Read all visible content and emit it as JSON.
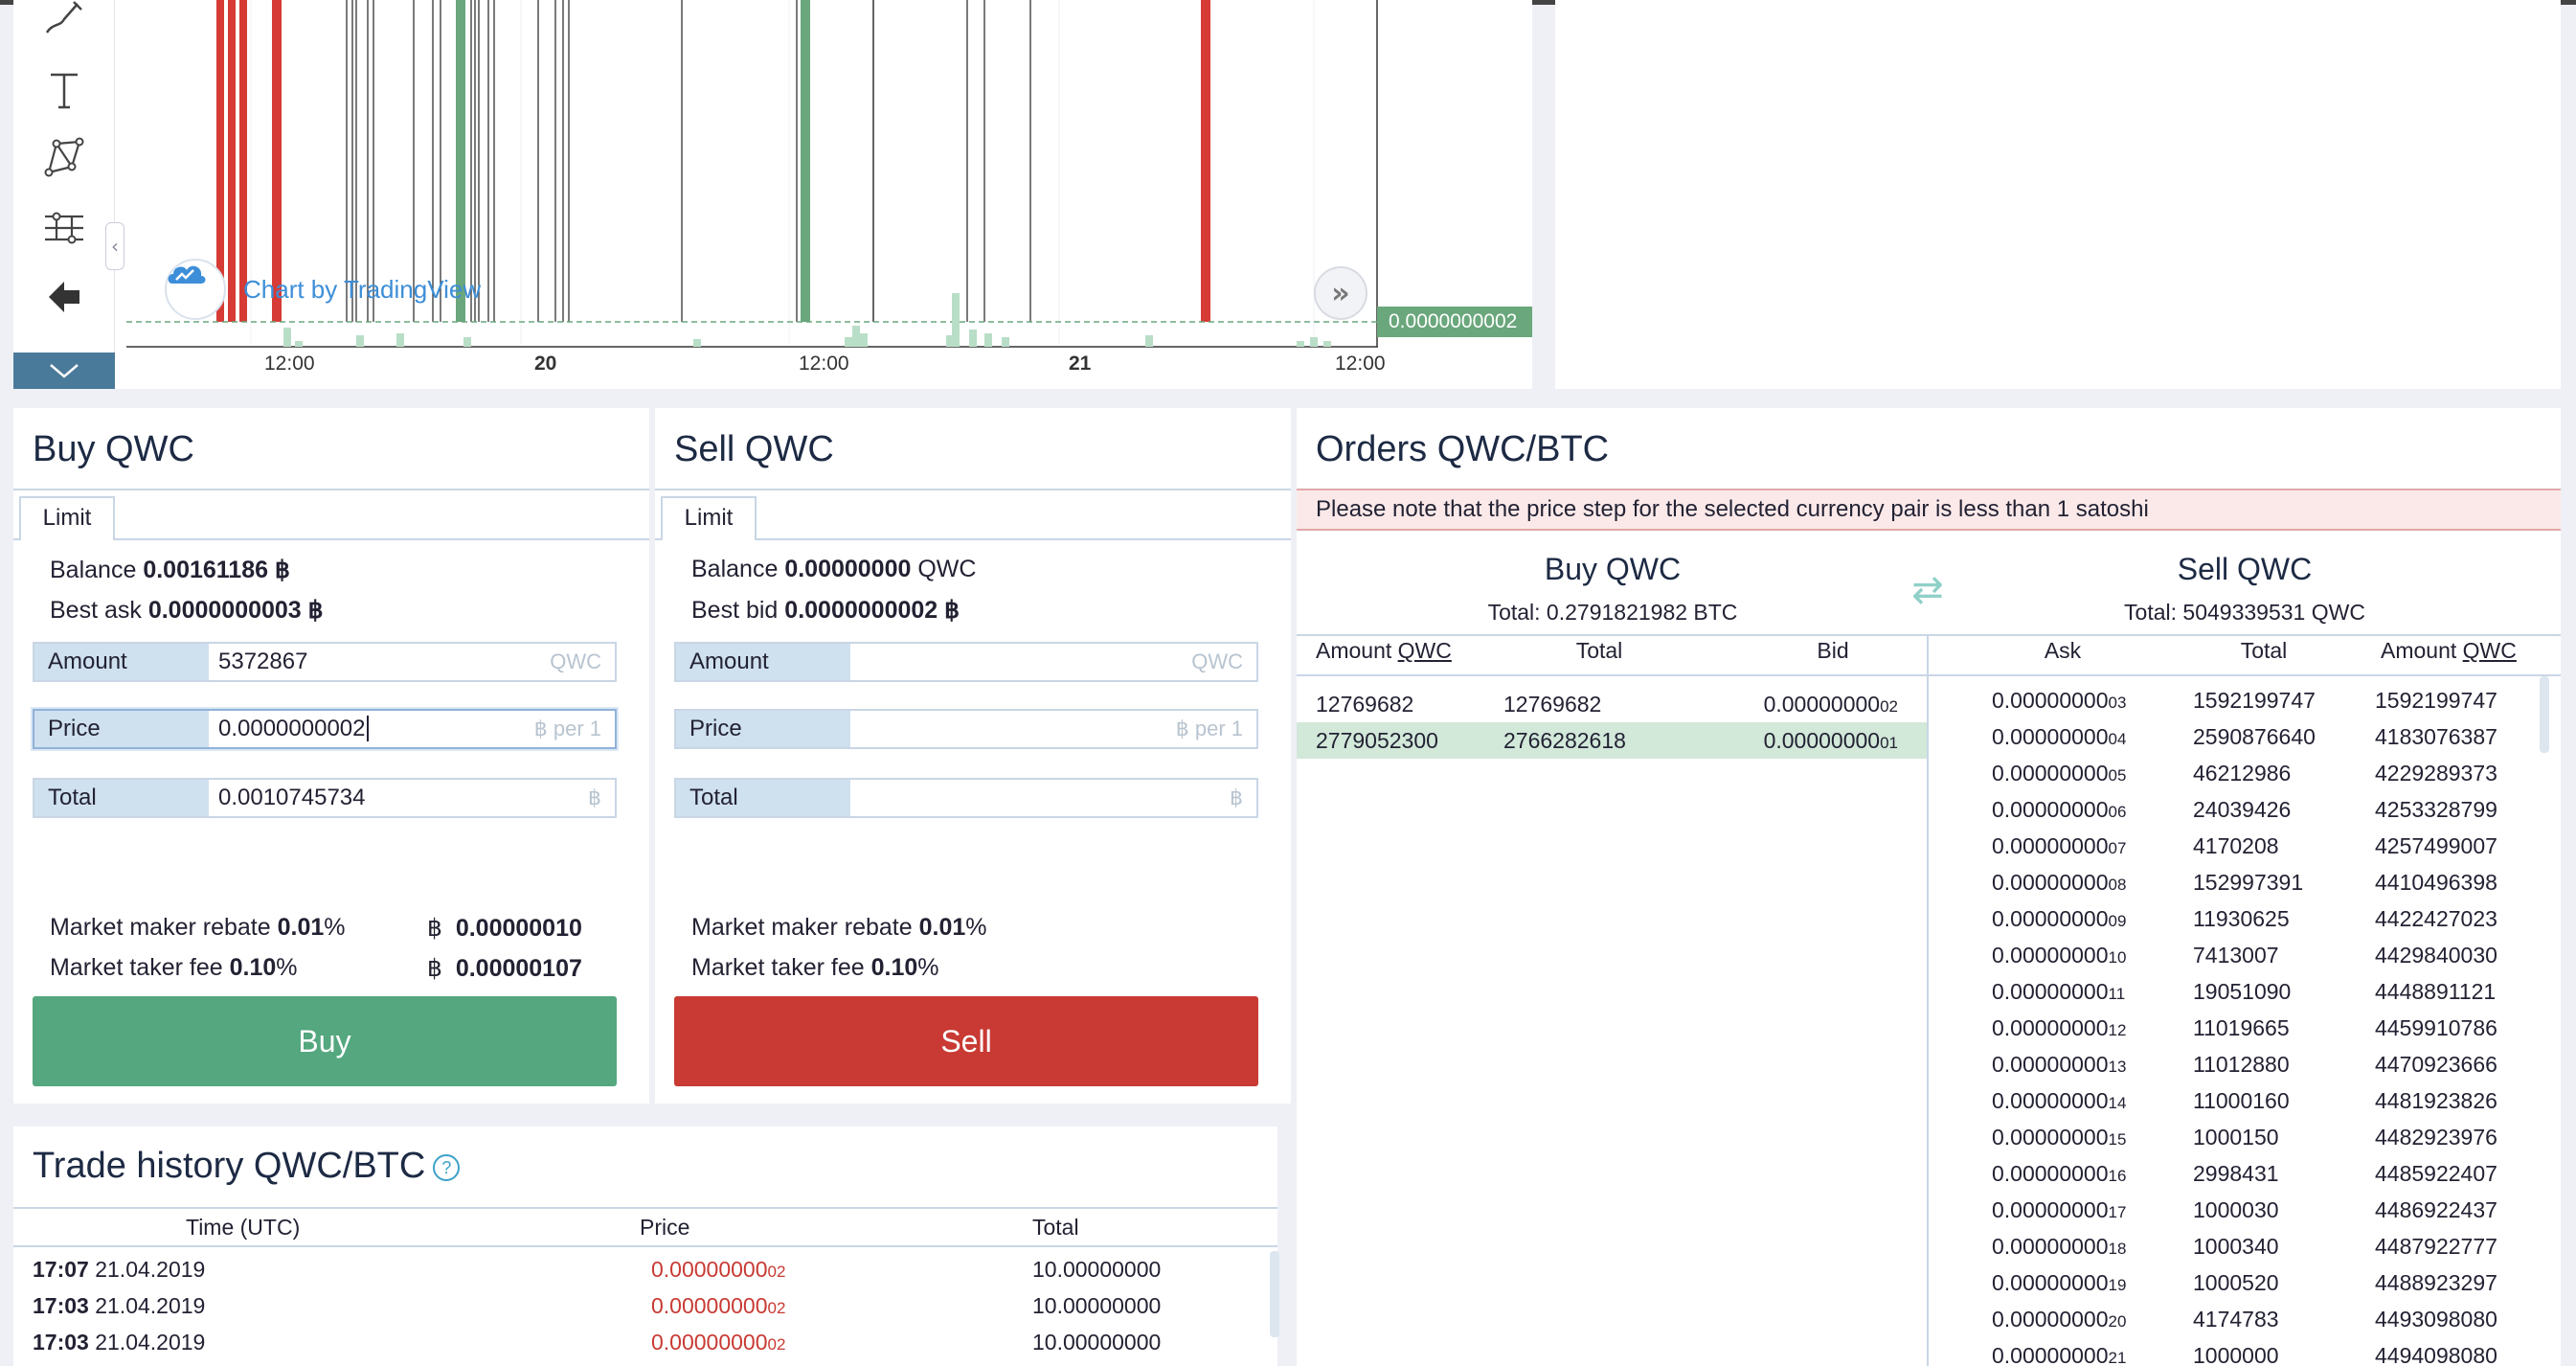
{
  "chart": {
    "watermark": "Chart by TradingView",
    "current_price": "0.0000000002",
    "x_ticks": [
      {
        "label": "12:00",
        "bold": false
      },
      {
        "label": "20",
        "bold": true
      },
      {
        "label": "12:00",
        "bold": false
      },
      {
        "label": "21",
        "bold": true
      },
      {
        "label": "12:00",
        "bold": false
      }
    ],
    "tools": [
      "brush-icon",
      "text-icon",
      "pattern-icon",
      "measure-icon",
      "back-arrow-icon"
    ],
    "colors": {
      "up": "#6aa77c",
      "down": "#d63b35",
      "volume": "#b9dec8"
    }
  },
  "buy": {
    "title": "Buy QWC",
    "tab": "Limit",
    "balance_label": "Balance",
    "balance_value": "0.00161186",
    "balance_unit": "฿",
    "best_label": "Best ask",
    "best_value_main": "0.0000000003",
    "best_unit": "฿",
    "amount_label": "Amount",
    "amount_value": "5372867",
    "amount_unit": "QWC",
    "price_label": "Price",
    "price_value": "0.0000000002",
    "price_unit": "฿ per 1",
    "total_label": "Total",
    "total_value": "0.0010745734",
    "total_unit": "฿",
    "maker_label": "Market maker rebate",
    "maker_pct": "0.01",
    "maker_value": "0.00000010",
    "taker_label": "Market taker fee",
    "taker_pct": "0.10",
    "taker_value": "0.00000107",
    "btc_sign": "฿",
    "button": "Buy"
  },
  "sell": {
    "title": "Sell QWC",
    "tab": "Limit",
    "balance_label": "Balance",
    "balance_value": "0.00000000",
    "balance_unit": "QWC",
    "best_label": "Best bid",
    "best_value_main": "0.0000000002",
    "best_unit": "฿",
    "amount_label": "Amount",
    "amount_unit": "QWC",
    "price_label": "Price",
    "price_unit": "฿ per 1",
    "total_label": "Total",
    "total_unit": "฿",
    "maker_label": "Market maker rebate",
    "maker_pct": "0.01",
    "taker_label": "Market taker fee",
    "taker_pct": "0.10",
    "button": "Sell"
  },
  "orders": {
    "title": "Orders QWC/BTC",
    "note": "Please note that the price step for the selected currency pair is less than 1 satoshi",
    "buy_title": "Buy QWC",
    "buy_total": "Total: 0.2791821982 BTC",
    "sell_title": "Sell QWC",
    "sell_total": "Total: 5049339531 QWC",
    "buy_cols": {
      "amount": "Amount",
      "amount_unit": "QWC",
      "total": "Total",
      "bid": "Bid"
    },
    "sell_cols": {
      "ask": "Ask",
      "total": "Total",
      "amount": "Amount",
      "amount_unit": "QWC"
    },
    "bids": [
      {
        "amount": "12769682",
        "total": "12769682",
        "price": "0.0000000002"
      },
      {
        "amount": "2779052300",
        "total": "2766282618",
        "price": "0.0000000001"
      }
    ],
    "asks": [
      {
        "price": "0.0000000003",
        "total": "1592199747",
        "amount": "1592199747"
      },
      {
        "price": "0.0000000004",
        "total": "2590876640",
        "amount": "4183076387"
      },
      {
        "price": "0.0000000005",
        "total": "46212986",
        "amount": "4229289373"
      },
      {
        "price": "0.0000000006",
        "total": "24039426",
        "amount": "4253328799"
      },
      {
        "price": "0.0000000007",
        "total": "4170208",
        "amount": "4257499007"
      },
      {
        "price": "0.0000000008",
        "total": "152997391",
        "amount": "4410496398"
      },
      {
        "price": "0.0000000009",
        "total": "11930625",
        "amount": "4422427023"
      },
      {
        "price": "0.0000000010",
        "total": "7413007",
        "amount": "4429840030"
      },
      {
        "price": "0.0000000011",
        "total": "19051090",
        "amount": "4448891121"
      },
      {
        "price": "0.0000000012",
        "total": "11019665",
        "amount": "4459910786"
      },
      {
        "price": "0.0000000013",
        "total": "11012880",
        "amount": "4470923666"
      },
      {
        "price": "0.0000000014",
        "total": "11000160",
        "amount": "4481923826"
      },
      {
        "price": "0.0000000015",
        "total": "1000150",
        "amount": "4482923976"
      },
      {
        "price": "0.0000000016",
        "total": "2998431",
        "amount": "4485922407"
      },
      {
        "price": "0.0000000017",
        "total": "1000030",
        "amount": "4486922437"
      },
      {
        "price": "0.0000000018",
        "total": "1000340",
        "amount": "4487922777"
      },
      {
        "price": "0.0000000019",
        "total": "1000520",
        "amount": "4488923297"
      },
      {
        "price": "0.0000000020",
        "total": "4174783",
        "amount": "4493098080"
      },
      {
        "price": "0.0000000021",
        "total": "1000000",
        "amount": "4494098080"
      }
    ]
  },
  "history": {
    "title": "Trade history QWC/BTC",
    "help": "?",
    "cols": {
      "time": "Time (UTC)",
      "price": "Price",
      "total": "Total"
    },
    "rows": [
      {
        "time": "17:07",
        "date": "21.04.2019",
        "price": "0.0000000002",
        "total": "10.00000000"
      },
      {
        "time": "17:03",
        "date": "21.04.2019",
        "price": "0.0000000002",
        "total": "10.00000000"
      },
      {
        "time": "17:03",
        "date": "21.04.2019",
        "price": "0.0000000002",
        "total": "10.00000000"
      }
    ]
  }
}
